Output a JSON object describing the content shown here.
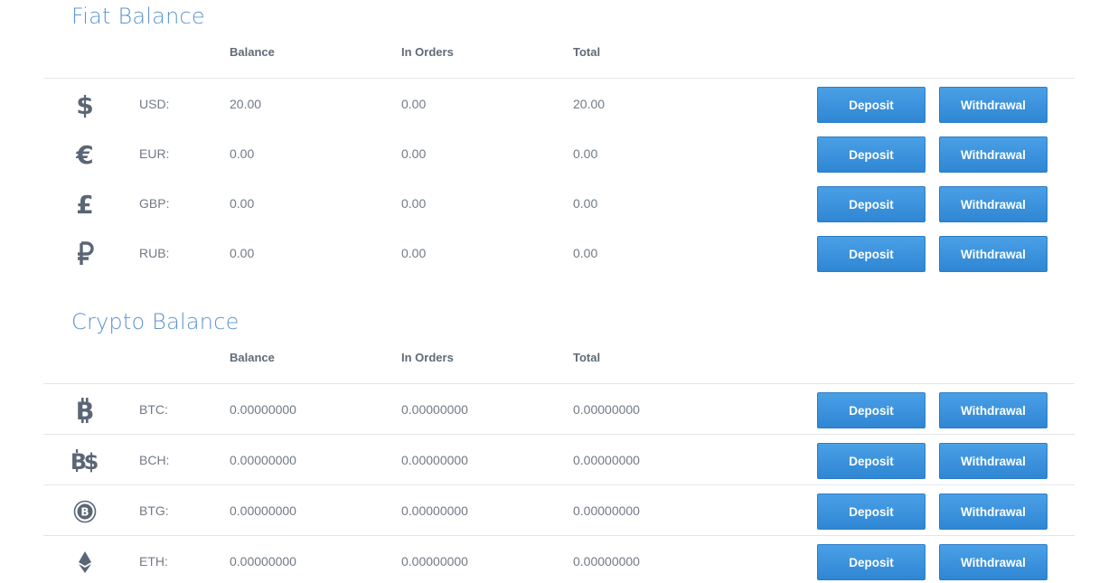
{
  "fiat": {
    "title": "Fiat Balance",
    "columns": {
      "balance": "Balance",
      "in_orders": "In Orders",
      "total": "Total"
    },
    "rows": [
      {
        "icon": "dollar-icon",
        "glyph": "$",
        "code": "USD:",
        "balance": "20.00",
        "in_orders": "0.00",
        "total": "20.00",
        "deposit": "Deposit",
        "withdrawal": "Withdrawal"
      },
      {
        "icon": "euro-icon",
        "glyph": "€",
        "code": "EUR:",
        "balance": "0.00",
        "in_orders": "0.00",
        "total": "0.00",
        "deposit": "Deposit",
        "withdrawal": "Withdrawal"
      },
      {
        "icon": "pound-icon",
        "glyph": "£",
        "code": "GBP:",
        "balance": "0.00",
        "in_orders": "0.00",
        "total": "0.00",
        "deposit": "Deposit",
        "withdrawal": "Withdrawal"
      },
      {
        "icon": "ruble-icon",
        "glyph": "₽",
        "code": "RUB:",
        "balance": "0.00",
        "in_orders": "0.00",
        "total": "0.00",
        "deposit": "Deposit",
        "withdrawal": "Withdrawal"
      }
    ]
  },
  "crypto": {
    "title": "Crypto Balance",
    "columns": {
      "balance": "Balance",
      "in_orders": "In Orders",
      "total": "Total"
    },
    "rows": [
      {
        "icon": "bitcoin-icon",
        "code": "BTC:",
        "balance": "0.00000000",
        "in_orders": "0.00000000",
        "total": "0.00000000",
        "deposit": "Deposit",
        "withdrawal": "Withdrawal"
      },
      {
        "icon": "bitcoin-cash-icon",
        "code": "BCH:",
        "balance": "0.00000000",
        "in_orders": "0.00000000",
        "total": "0.00000000",
        "deposit": "Deposit",
        "withdrawal": "Withdrawal"
      },
      {
        "icon": "bitcoin-gold-icon",
        "code": "BTG:",
        "balance": "0.00000000",
        "in_orders": "0.00000000",
        "total": "0.00000000",
        "deposit": "Deposit",
        "withdrawal": "Withdrawal"
      },
      {
        "icon": "ethereum-icon",
        "code": "ETH:",
        "balance": "0.00000000",
        "in_orders": "0.00000000",
        "total": "0.00000000",
        "deposit": "Deposit",
        "withdrawal": "Withdrawal"
      }
    ]
  },
  "colors": {
    "title": "#5d95cf",
    "button": "#3a92dc",
    "icon": "#5a6676",
    "text": "#717a85"
  }
}
